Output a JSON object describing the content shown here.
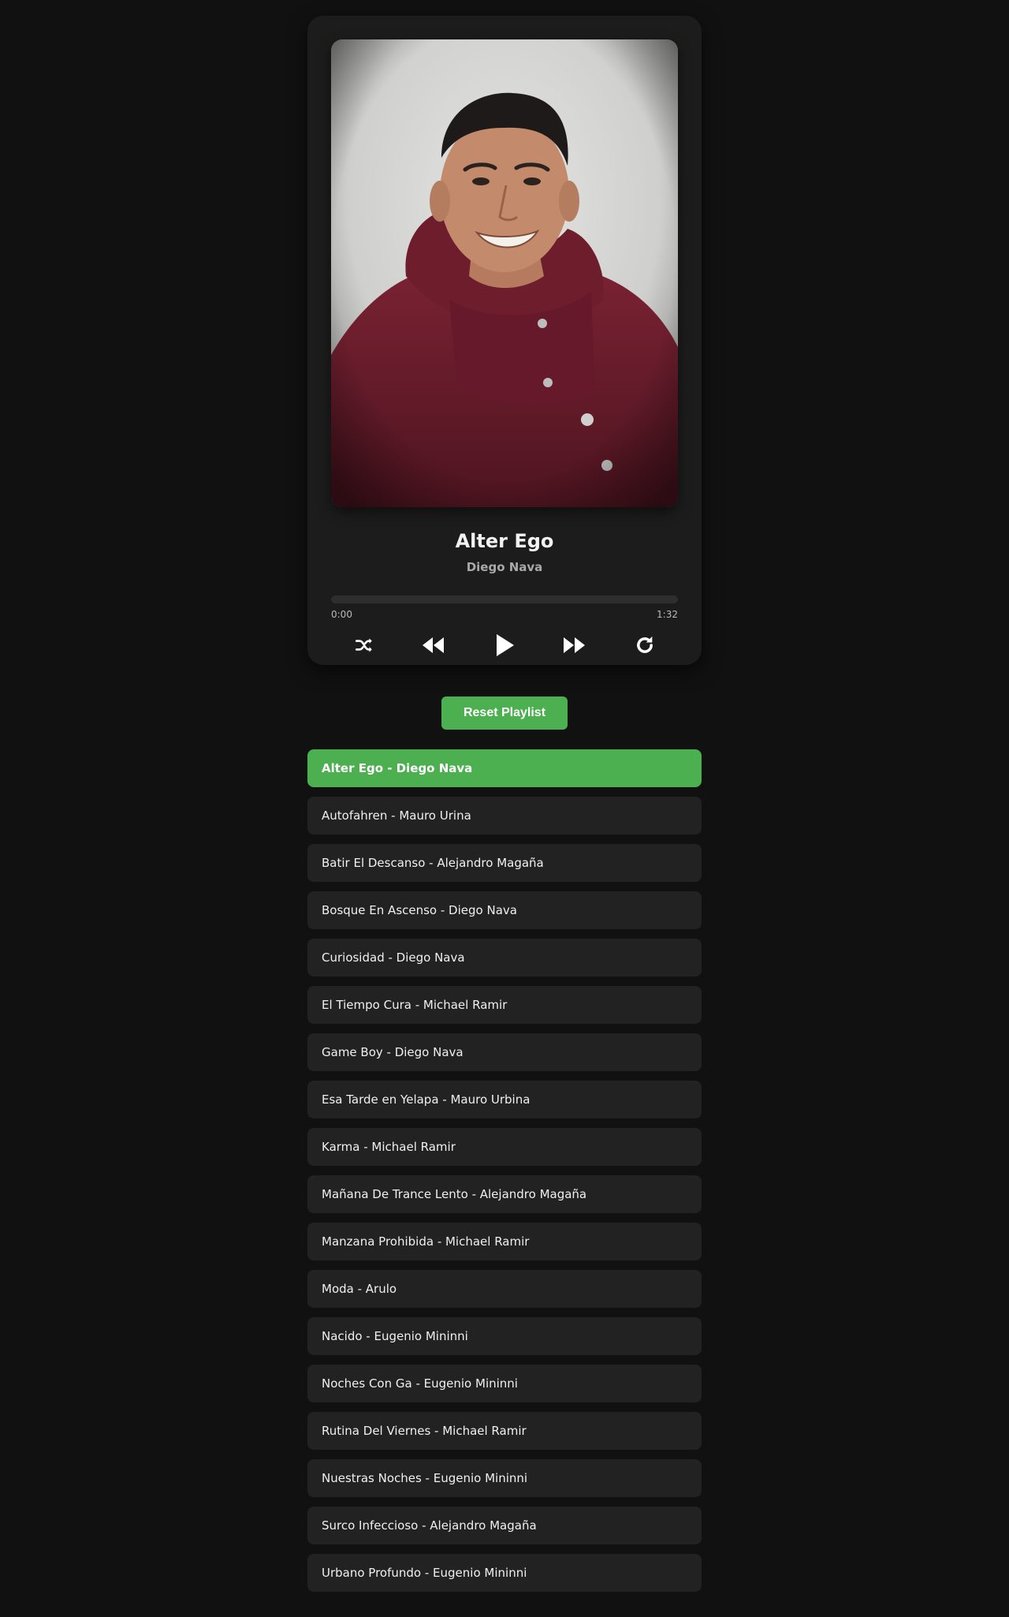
{
  "player": {
    "album_art": "artist-photo",
    "track_title": "Alter Ego",
    "track_artist": "Diego Nava",
    "progress": 0,
    "current_time": "0:00",
    "total_time": "1:32",
    "controls": [
      {
        "name": "shuffle-button",
        "icon": "shuffle-icon"
      },
      {
        "name": "previous-button",
        "icon": "rewind-icon"
      },
      {
        "name": "play-button",
        "icon": "play-icon"
      },
      {
        "name": "next-button",
        "icon": "fast-forward-icon"
      },
      {
        "name": "repeat-button",
        "icon": "repeat-icon"
      }
    ]
  },
  "reset_label": "Reset Playlist",
  "colors": {
    "accent": "#4caf50",
    "background": "#111111",
    "card": "#1c1c1c",
    "item": "#222222"
  },
  "playlist": [
    {
      "label": "Alter Ego - Diego Nava",
      "active": true
    },
    {
      "label": "Autofahren - Mauro Urina",
      "active": false
    },
    {
      "label": "Batir El Descanso - Alejandro Magaña",
      "active": false
    },
    {
      "label": "Bosque En Ascenso - Diego Nava",
      "active": false
    },
    {
      "label": "Curiosidad - Diego Nava",
      "active": false
    },
    {
      "label": "El Tiempo Cura - Michael Ramir",
      "active": false
    },
    {
      "label": "Game Boy - Diego Nava",
      "active": false
    },
    {
      "label": "Esa Tarde en Yelapa - Mauro Urbina",
      "active": false
    },
    {
      "label": "Karma - Michael Ramir",
      "active": false
    },
    {
      "label": "Mañana De Trance Lento - Alejandro Magaña",
      "active": false
    },
    {
      "label": "Manzana Prohibida - Michael Ramir",
      "active": false
    },
    {
      "label": "Moda - Arulo",
      "active": false
    },
    {
      "label": "Nacido - Eugenio Mininni",
      "active": false
    },
    {
      "label": "Noches Con Ga - Eugenio Mininni",
      "active": false
    },
    {
      "label": "Rutina Del Viernes - Michael Ramir",
      "active": false
    },
    {
      "label": "Nuestras Noches - Eugenio Mininni",
      "active": false
    },
    {
      "label": "Surco Infeccioso - Alejandro Magaña",
      "active": false
    },
    {
      "label": "Urbano Profundo - Eugenio Mininni",
      "active": false
    }
  ]
}
